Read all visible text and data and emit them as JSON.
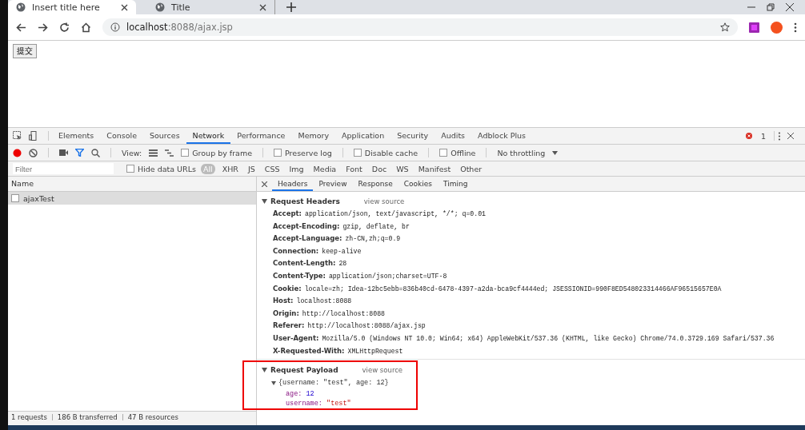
{
  "browser": {
    "tabs": [
      {
        "title": "Insert title here",
        "selected": true
      },
      {
        "title": "Title",
        "selected": false
      }
    ],
    "address": {
      "host": "localhost",
      "rest": ":8088/ajax.jsp"
    }
  },
  "page": {
    "button": "提交"
  },
  "devtools": {
    "panel_tabs": [
      {
        "label": "Elements",
        "selected": false
      },
      {
        "label": "Console",
        "selected": false
      },
      {
        "label": "Sources",
        "selected": false
      },
      {
        "label": "Network",
        "selected": true
      },
      {
        "label": "Performance",
        "selected": false
      },
      {
        "label": "Memory",
        "selected": false
      },
      {
        "label": "Application",
        "selected": false
      },
      {
        "label": "Security",
        "selected": false
      },
      {
        "label": "Audits",
        "selected": false
      },
      {
        "label": "Adblock Plus",
        "selected": false
      }
    ],
    "error_count": "1",
    "toolbar": {
      "recording": true,
      "view_label": "View:",
      "checkboxes": [
        {
          "label": "Group by frame",
          "checked": false
        },
        {
          "label": "Preserve log",
          "checked": false
        },
        {
          "label": "Disable cache",
          "checked": false
        },
        {
          "label": "Offline",
          "checked": false
        }
      ],
      "throttling": "No throttling"
    },
    "filter": {
      "placeholder": "Filter",
      "hide_data_urls": {
        "label": "Hide data URLs",
        "checked": false
      },
      "types": [
        {
          "label": "All",
          "selected": true
        },
        {
          "label": "XHR",
          "selected": false
        },
        {
          "label": "JS",
          "selected": false
        },
        {
          "label": "CSS",
          "selected": false
        },
        {
          "label": "Img",
          "selected": false
        },
        {
          "label": "Media",
          "selected": false
        },
        {
          "label": "Font",
          "selected": false
        },
        {
          "label": "Doc",
          "selected": false
        },
        {
          "label": "WS",
          "selected": false
        },
        {
          "label": "Manifest",
          "selected": false
        },
        {
          "label": "Other",
          "selected": false
        }
      ]
    },
    "requests": {
      "column": "Name",
      "rows": [
        {
          "name": "ajaxTest",
          "selected": true
        }
      ]
    },
    "detail_tabs": [
      {
        "label": "Headers",
        "selected": true
      },
      {
        "label": "Preview",
        "selected": false
      },
      {
        "label": "Response",
        "selected": false
      },
      {
        "label": "Cookies",
        "selected": false
      },
      {
        "label": "Timing",
        "selected": false
      }
    ],
    "request_headers": {
      "title": "Request Headers",
      "link": "view source",
      "expanded": true,
      "rows": [
        {
          "name": "Accept:",
          "value": "application/json, text/javascript, */*; q=0.01"
        },
        {
          "name": "Accept-Encoding:",
          "value": "gzip, deflate, br"
        },
        {
          "name": "Accept-Language:",
          "value": "zh-CN,zh;q=0.9"
        },
        {
          "name": "Connection:",
          "value": "keep-alive"
        },
        {
          "name": "Content-Length:",
          "value": "28"
        },
        {
          "name": "Content-Type:",
          "value": "application/json;charset=UTF-8"
        },
        {
          "name": "Cookie:",
          "value": "locale=zh; Idea-12bc5ebb=836b40cd-6478-4397-a2da-bca9cf4444ed; JSESSIONID=990F8ED548023314466AF96515657E0A"
        },
        {
          "name": "Host:",
          "value": "localhost:8088"
        },
        {
          "name": "Origin:",
          "value": "http://localhost:8088"
        },
        {
          "name": "Referer:",
          "value": "http://localhost:8088/ajax.jsp"
        },
        {
          "name": "User-Agent:",
          "value": "Mozilla/5.0 (Windows NT 10.0; Win64; x64) AppleWebKit/537.36 (KHTML, like Gecko) Chrome/74.0.3729.169 Safari/537.36"
        },
        {
          "name": "X-Requested-With:",
          "value": "XMLHttpRequest"
        }
      ]
    },
    "payload": {
      "title": "Request Payload",
      "link": "view source",
      "expanded": true,
      "highlighted": true,
      "summary": "{username: \"test\", age: 12}",
      "summary_expanded": true,
      "children": [
        {
          "key": "age:",
          "value": "12",
          "kind": "number"
        },
        {
          "key": "username:",
          "value": "\"test\"",
          "kind": "string"
        }
      ]
    },
    "status": [
      "1 requests",
      "186 B transferred",
      "47 B resources"
    ]
  }
}
